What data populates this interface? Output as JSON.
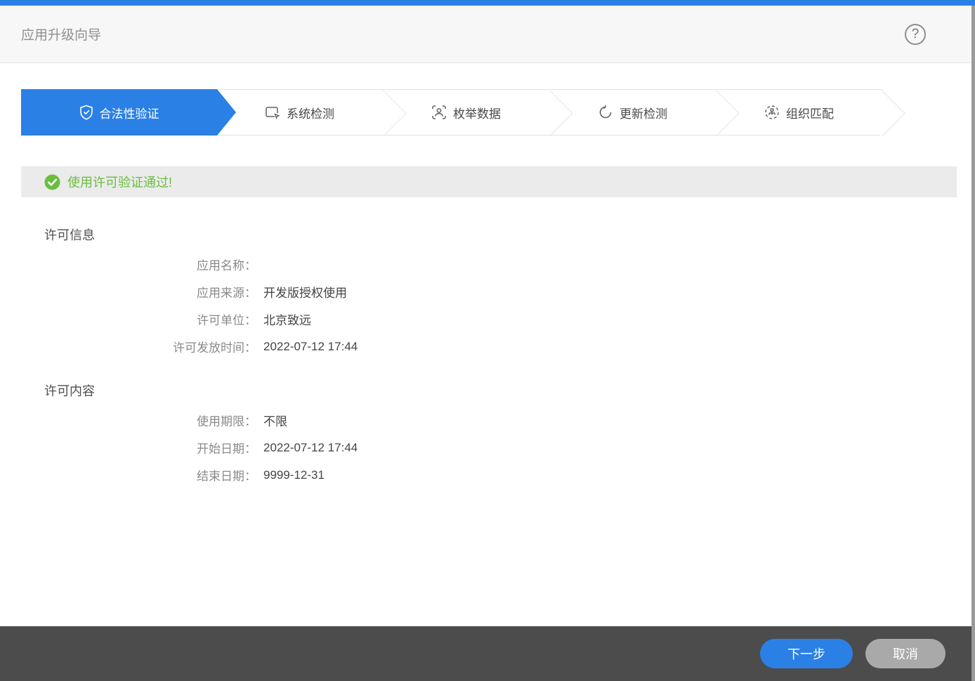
{
  "window": {
    "title": "应用升级向导",
    "help_icon": "?"
  },
  "colors": {
    "accent_blue": "#2b80e6",
    "success_green": "#6abe3e",
    "footer_gray": "#4c4c4c",
    "cancel_gray": "#a9a9a9"
  },
  "stepper": {
    "steps": [
      {
        "label": "合法性验证",
        "icon": "shield-check-icon",
        "active": true
      },
      {
        "label": "系统检测",
        "icon": "monitor-cursor-icon",
        "active": false
      },
      {
        "label": "枚举数据",
        "icon": "face-scan-icon",
        "active": false
      },
      {
        "label": "更新检测",
        "icon": "refresh-icon",
        "active": false
      },
      {
        "label": "组织匹配",
        "icon": "org-match-icon",
        "active": false
      }
    ]
  },
  "message": {
    "icon": "check-circle-icon",
    "text": "使用许可验证通过!"
  },
  "sections": [
    {
      "title": "许可信息",
      "rows": [
        {
          "label": "应用名称：",
          "value": ""
        },
        {
          "label": "应用来源：",
          "value": "开发版授权使用"
        },
        {
          "label": "许可单位：",
          "value": "北京致远"
        },
        {
          "label": "许可发放时间：",
          "value": "2022-07-12 17:44"
        }
      ]
    },
    {
      "title": "许可内容",
      "rows": [
        {
          "label": "使用期限：",
          "value": "不限"
        },
        {
          "label": "开始日期：",
          "value": "2022-07-12 17:44"
        },
        {
          "label": "结束日期：",
          "value": "9999-12-31"
        }
      ]
    }
  ],
  "footer": {
    "next_label": "下一步",
    "cancel_label": "取消"
  }
}
